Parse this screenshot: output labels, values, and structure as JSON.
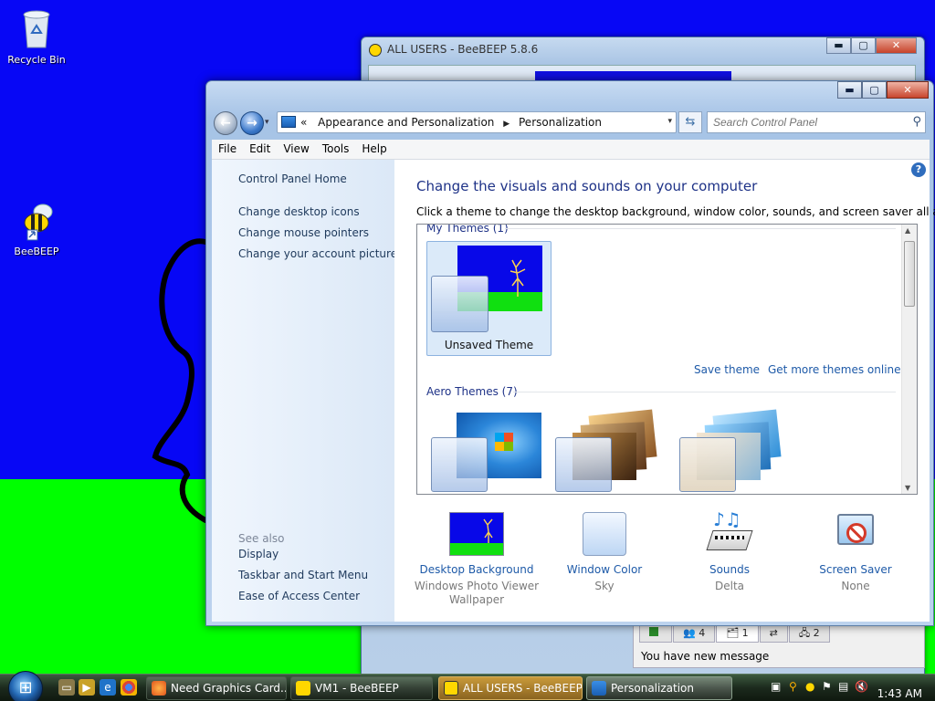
{
  "desktop": {
    "icons": [
      {
        "label": "Recycle Bin",
        "icon": "recycle-bin-icon"
      },
      {
        "label": "BeeBEEP",
        "icon": "bee-icon"
      }
    ]
  },
  "bg_window": {
    "title": "ALL USERS - BeeBEEP 5.8.6",
    "tabs": [
      "4",
      "1",
      "",
      "2"
    ],
    "message": "You have new message"
  },
  "window": {
    "caption_buttons": {
      "minimize": "▬",
      "maximize": "▢",
      "close": "✕"
    },
    "breadcrumb": {
      "prefix": "«",
      "items": [
        "Appearance and Personalization",
        "Personalization"
      ]
    },
    "search_placeholder": "Search Control Panel",
    "menu": [
      "File",
      "Edit",
      "View",
      "Tools",
      "Help"
    ],
    "left_links": [
      "Control Panel Home",
      "Change desktop icons",
      "Change mouse pointers",
      "Change your account picture"
    ],
    "see_also": {
      "heading": "See also",
      "links": [
        "Display",
        "Taskbar and Start Menu",
        "Ease of Access Center"
      ]
    },
    "heading": "Change the visuals and sounds on your computer",
    "subtitle": "Click a theme to change the desktop background, window color, sounds, and screen saver all at once.",
    "my_themes": {
      "label": "My Themes (1)",
      "items": [
        {
          "name": "Unsaved Theme"
        }
      ]
    },
    "theme_actions": {
      "save": "Save theme",
      "more": "Get more themes online"
    },
    "aero_themes": {
      "label": "Aero Themes (7)"
    },
    "bottom": [
      {
        "label": "Desktop Background",
        "value": "Windows Photo Viewer Wallpaper",
        "icon": "desktop-background-icon"
      },
      {
        "label": "Window Color",
        "value": "Sky",
        "icon": "window-color-icon"
      },
      {
        "label": "Sounds",
        "value": "Delta",
        "icon": "sounds-icon"
      },
      {
        "label": "Screen Saver",
        "value": "None",
        "icon": "screen-saver-icon"
      }
    ],
    "help_icon": "?"
  },
  "taskbar": {
    "buttons": [
      {
        "label": "Need Graphics Card..."
      },
      {
        "label": "VM1 - BeeBEEP"
      },
      {
        "label": "ALL USERS - BeeBEEP..."
      },
      {
        "label": "Personalization"
      }
    ],
    "clock": "1:43 AM"
  },
  "colors": {
    "desktop_blue": "#0707f5",
    "desktop_green": "#00ff00",
    "link": "#1e5aa8",
    "heading": "#1e3287"
  }
}
